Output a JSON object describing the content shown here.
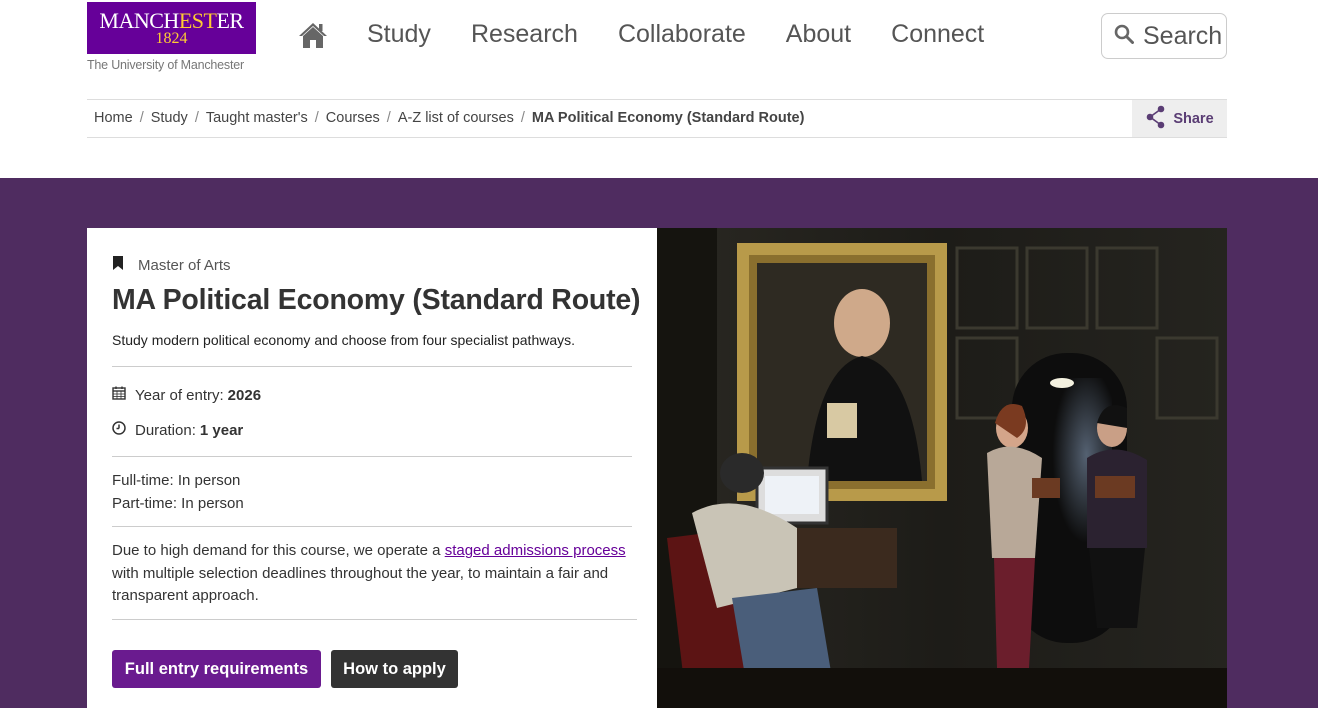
{
  "header": {
    "logo": {
      "word_pre": "MANCH",
      "word_gold": "EST",
      "word_post": "ER",
      "year": "1824",
      "subtitle": "The University of Manchester"
    },
    "nav": [
      "Study",
      "Research",
      "Collaborate",
      "About",
      "Connect"
    ],
    "search_label": "Search"
  },
  "breadcrumb": {
    "items": [
      "Home",
      "Study",
      "Taught master's",
      "Courses",
      "A-Z list of courses"
    ],
    "current": "MA Political Economy (Standard Route)",
    "separator": "/",
    "share_label": "Share"
  },
  "course": {
    "qualification": "Master of Arts",
    "title": "MA Political Economy (Standard Route)",
    "summary": "Study modern political economy and choose from four specialist pathways.",
    "year_label": "Year of entry:",
    "year_value": "2026",
    "duration_label": "Duration:",
    "duration_value": "1 year",
    "full_time": "Full-time: In person",
    "part_time": "Part-time: In person",
    "note_pre": "Due to high demand for this course, we operate a ",
    "note_link": "staged admissions process",
    "note_post": " with multiple selection deadlines throughout the year, to maintain a fair and transparent approach.",
    "btn_requirements": "Full entry requirements",
    "btn_apply": "How to apply"
  },
  "colors": {
    "brand_purple": "#660099",
    "band_purple": "#4f2c60",
    "logo_gold": "#ffcc33",
    "dark_button": "#333333"
  }
}
